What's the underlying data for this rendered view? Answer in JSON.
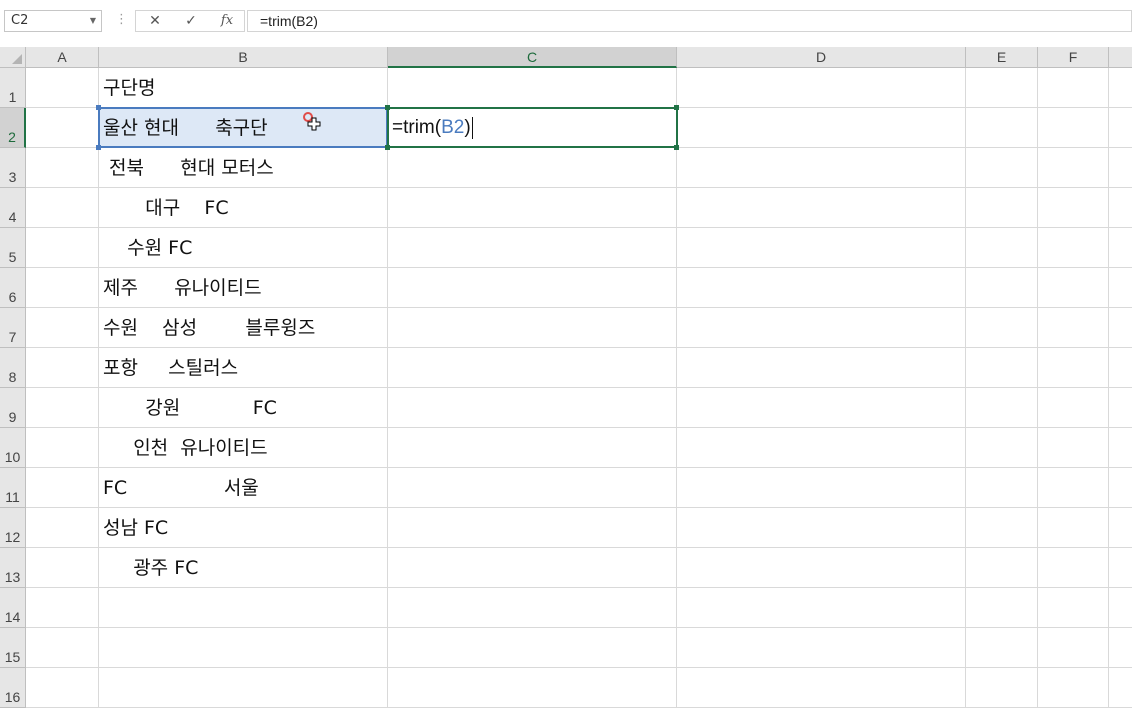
{
  "formula_bar": {
    "name_box": "C2",
    "cancel_glyph": "✕",
    "enter_glyph": "✓",
    "fx_label": "fx",
    "formula": "=trim(B2)"
  },
  "columns": [
    "A",
    "B",
    "C",
    "D",
    "E",
    "F"
  ],
  "rows": [
    "1",
    "2",
    "3",
    "4",
    "5",
    "6",
    "7",
    "8",
    "9",
    "10",
    "11",
    "12",
    "13",
    "14",
    "15",
    "16"
  ],
  "column_b_values": [
    "구단명",
    "울산 현대      축구단",
    " 전북      현대 모터스",
    "       대구    FC",
    "    수원 FC",
    "제주      유나이티드",
    "수원    삼성        블루윙즈",
    "포항     스틸러스",
    "       강원            FC",
    "     인천  유나이티드",
    "FC                서울",
    "성남 FC",
    "     광주 FC"
  ],
  "c2_editor": {
    "prefix": "=trim(",
    "ref": "B2",
    "suffix": ")"
  },
  "selection": {
    "active_cell": "C2",
    "referenced_cell": "B2",
    "accent": "#217346",
    "ref_color": "#4a7bbf"
  }
}
